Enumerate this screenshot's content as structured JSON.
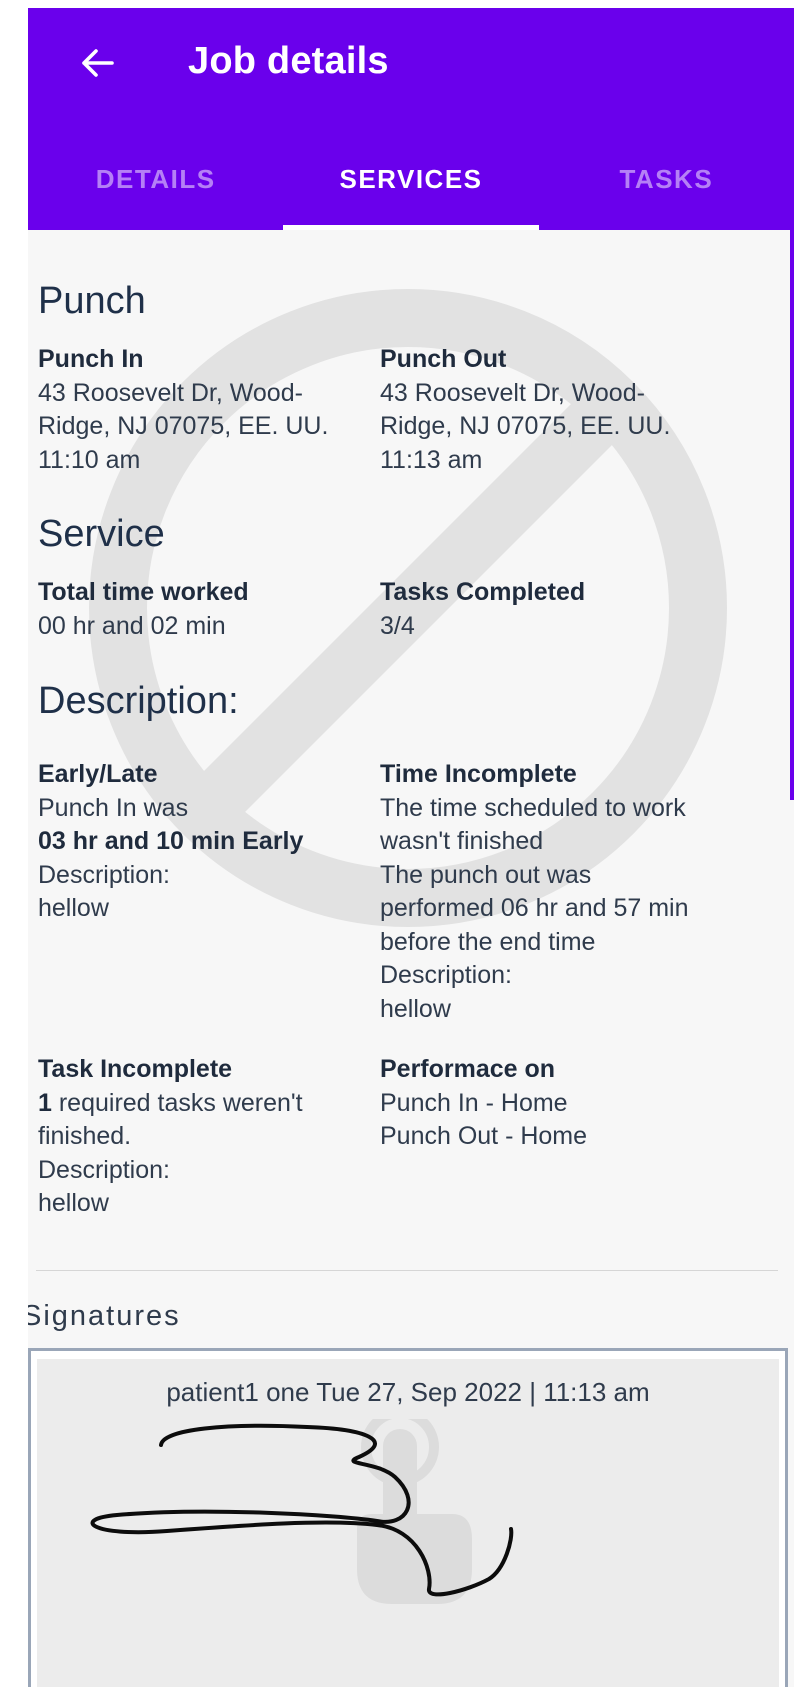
{
  "header": {
    "title": "Job details",
    "back_icon": "arrow-left-icon",
    "background": "#6a00ec"
  },
  "tabs": [
    {
      "label": "DETAILS",
      "active": false
    },
    {
      "label": "SERVICES",
      "active": true
    },
    {
      "label": "TASKS",
      "active": false
    }
  ],
  "punch": {
    "title": "Punch",
    "punch_in": {
      "label": "Punch In",
      "address_line1": "43 Roosevelt Dr, Wood-",
      "address_line2": "Ridge, NJ 07075, EE. UU.",
      "time": "11:10 am"
    },
    "punch_out": {
      "label": "Punch Out",
      "address_line1": "43 Roosevelt Dr, Wood-",
      "address_line2": "Ridge, NJ 07075, EE. UU.",
      "time": "11:13 am"
    }
  },
  "service": {
    "title": "Service",
    "total_time": {
      "label": "Total time worked",
      "value": "00 hr and 02 min"
    },
    "tasks_completed": {
      "label": "Tasks Completed",
      "value": "3/4"
    }
  },
  "description": {
    "title": "Description:",
    "early_late": {
      "label": "Early/Late",
      "line1": "Punch In was",
      "highlight": "03 hr and 10 min Early",
      "desc_label": "Description:",
      "desc_value": "hellow"
    },
    "time_incomplete": {
      "label": "Time Incomplete",
      "line1": "The time scheduled to work",
      "line2": "wasn't finished",
      "line3": "The punch out was",
      "line4": "performed 06 hr and 57 min",
      "line5": "before the end time",
      "desc_label": "Description:",
      "desc_value": "hellow"
    },
    "task_incomplete": {
      "label": "Task Incomplete",
      "count": "1",
      "line1_rest": " required tasks weren't",
      "line2": "finished.",
      "desc_label": "Description:",
      "desc_value": "hellow"
    },
    "performance": {
      "label": "Performace on",
      "line1": "Punch In - Home",
      "line2": "Punch Out - Home"
    }
  },
  "signatures": {
    "title": "Signatures",
    "entry": {
      "signer": "patient1 one",
      "datetime": "Tue 27, Sep 2022 | 11:13 am"
    }
  },
  "watermark_icon": "no-entry-icon",
  "signature_watermark_icon": "touch-hand-icon"
}
